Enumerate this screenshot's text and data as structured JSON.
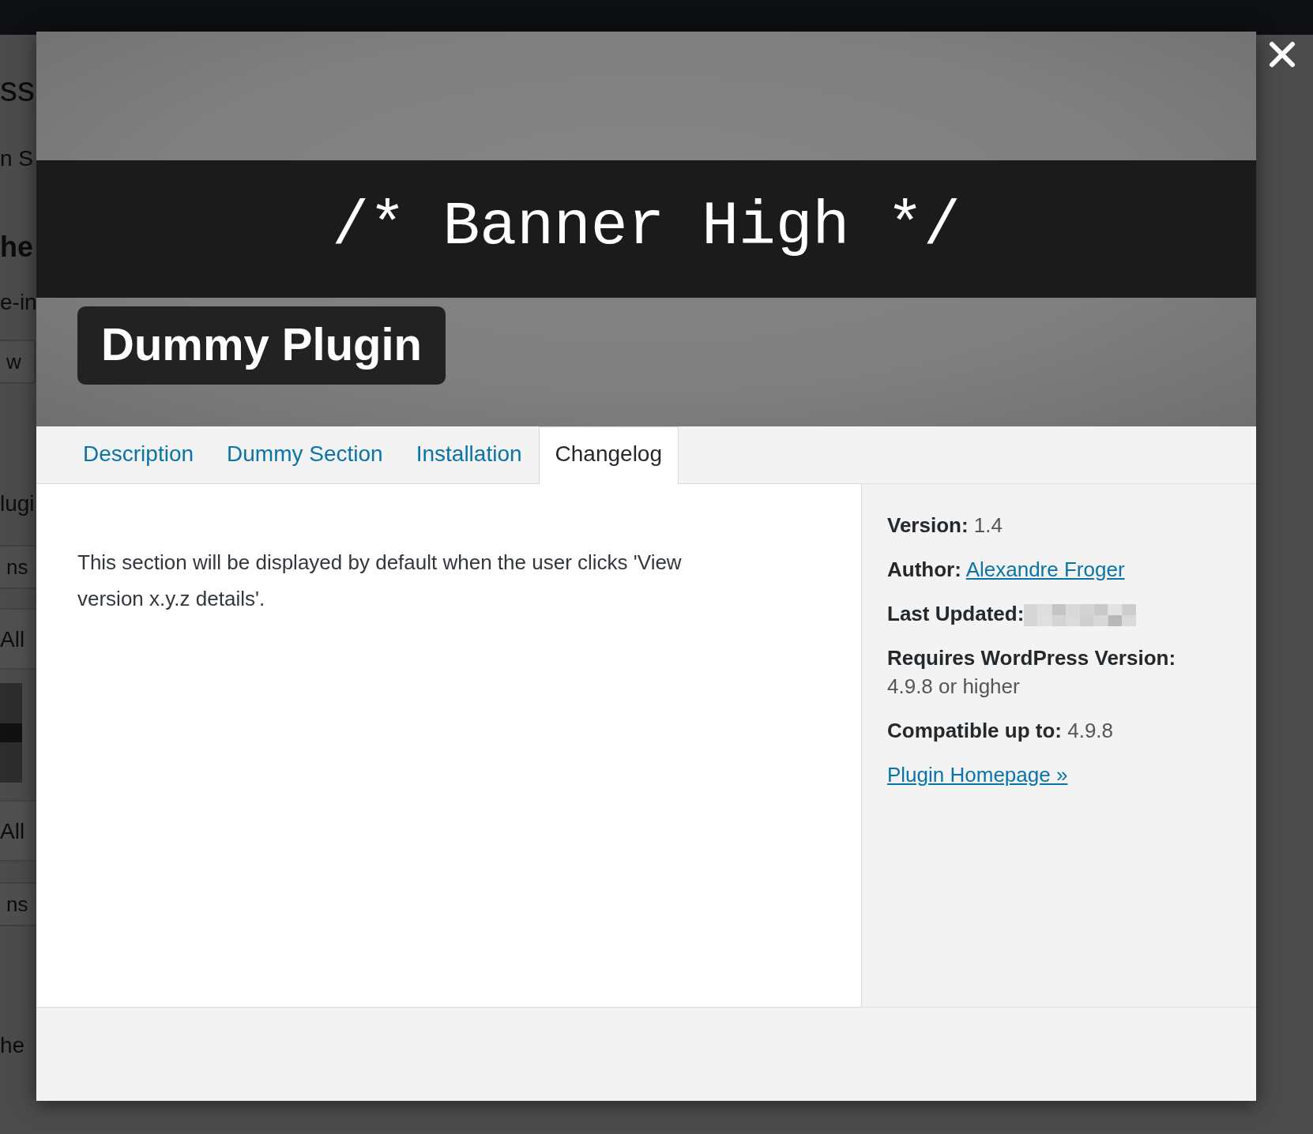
{
  "background_page": {
    "fragments": [
      {
        "text": "ss",
        "kind": "heading"
      },
      {
        "text": "n S",
        "kind": "text"
      },
      {
        "text": "he",
        "kind": "subheading"
      },
      {
        "text": "e-in",
        "kind": "text"
      },
      {
        "text": "w",
        "kind": "button"
      },
      {
        "text": "lugi",
        "kind": "text"
      },
      {
        "text": "ns",
        "kind": "button"
      },
      {
        "text": "All",
        "kind": "row"
      },
      {
        "kind": "thumbnail"
      },
      {
        "text": "All",
        "kind": "row"
      },
      {
        "text": "ns",
        "kind": "button"
      },
      {
        "text": "he",
        "kind": "text"
      }
    ]
  },
  "modal": {
    "banner": {
      "text": "/* Banner High */"
    },
    "plugin_name": "Dummy Plugin",
    "tabs": [
      {
        "label": "Description",
        "selected": false
      },
      {
        "label": "Dummy Section",
        "selected": false
      },
      {
        "label": "Installation",
        "selected": false
      },
      {
        "label": "Changelog",
        "selected": true
      }
    ],
    "content": "This section will be displayed by default when the user clicks 'View version x.y.z details'.",
    "details": [
      {
        "kind": "text",
        "label": "Version:",
        "value": "1.4"
      },
      {
        "kind": "link",
        "label": "Author:",
        "value": "Alexandre Froger"
      },
      {
        "kind": "redacted",
        "label": "Last Updated:"
      },
      {
        "kind": "block",
        "label": "Requires WordPress Version:",
        "value": "4.9.8 or higher"
      },
      {
        "kind": "text",
        "label": "Compatible up to:",
        "value": "4.9.8"
      },
      {
        "kind": "homepage",
        "value": "Plugin Homepage »"
      }
    ]
  }
}
